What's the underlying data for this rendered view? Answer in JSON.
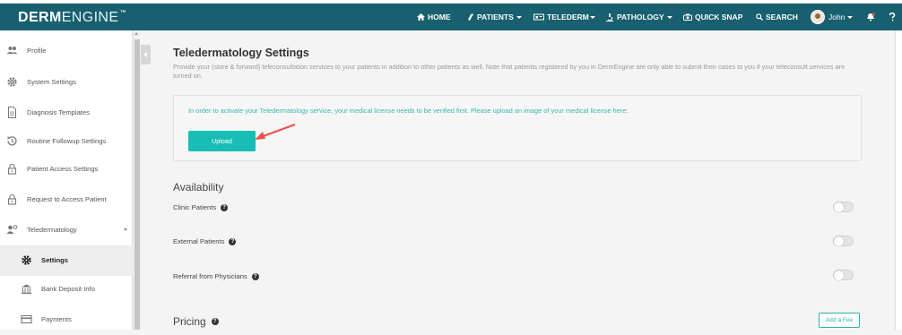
{
  "brand": {
    "part1": "DERM",
    "part2": "ENGINE",
    "tm": "™"
  },
  "nav": {
    "home": "HOME",
    "patients": "PATIENTS",
    "telederm": "TELEDERM",
    "pathology": "PATHOLOGY",
    "quick_snap": "QUICK SNAP",
    "search": "SEARCH",
    "user": "John"
  },
  "sidebar": {
    "items": [
      {
        "label": "Profile",
        "icon": "users-icon"
      },
      {
        "label": "System Settings",
        "icon": "gear-icon"
      },
      {
        "label": "Diagnosis Templates",
        "icon": "document-icon"
      },
      {
        "label": "Routine Followup Settings",
        "icon": "history-icon"
      },
      {
        "label": "Patient Access Settings",
        "icon": "lock-icon"
      },
      {
        "label": "Request to Access Patient",
        "icon": "lock-icon"
      },
      {
        "label": "Teledermatology",
        "icon": "user-gear-icon"
      },
      {
        "label": "Settings",
        "icon": "gear-icon"
      },
      {
        "label": "Bank Deposit Info",
        "icon": "bank-icon"
      },
      {
        "label": "Payments",
        "icon": "credit-card-icon"
      }
    ]
  },
  "main": {
    "title": "Teledermatology Settings",
    "description": "Provide your (store & forward) teleconsultation services to your patients in addition to other patients as well. Note that patients registered by you in DermEngine are only able to submit their cases to you if your teleconsult services are turned on.",
    "notice": "In order to activate your Teledermatology service, your medical license needs to be verified first. Please upload an image of your medical license here:",
    "upload_label": "Upload",
    "availability": {
      "title": "Availability",
      "rows": [
        {
          "label": "Clinic Patients",
          "enabled": false
        },
        {
          "label": "External Patients",
          "enabled": false
        },
        {
          "label": "Referral from Physicians",
          "enabled": false
        }
      ]
    },
    "pricing": {
      "title": "Pricing",
      "add_fee_label": "Add a Fee"
    }
  },
  "colors": {
    "topbar": "#186070",
    "accent": "#18bdb3",
    "notice_text": "#33b8b1",
    "arrow": "#e8544a"
  }
}
